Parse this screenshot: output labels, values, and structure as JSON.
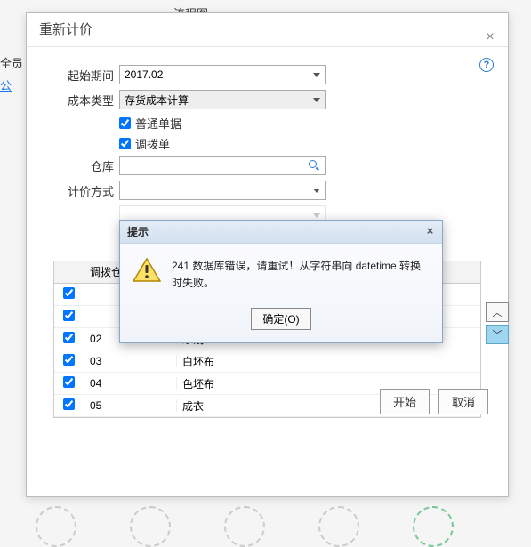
{
  "background": {
    "flowchart_label": "流程图",
    "members_label": "全员",
    "public_label": "公"
  },
  "dialog": {
    "title": "重新计价",
    "close": "×",
    "help": "?",
    "fields": {
      "start_period_label": "起始期间",
      "start_period_value": "2017.02",
      "cost_type_label": "成本类型",
      "cost_type_value": "存货成本计算",
      "normal_receipt_label": "普通单据",
      "transfer_receipt_label": "调拨单",
      "warehouse_label": "仓库",
      "warehouse_value": "",
      "pricing_method_label": "计价方式",
      "pricing_method_value": ""
    },
    "table": {
      "header_code": "调拨仓",
      "header_name": "",
      "rows": [
        {
          "checked": true,
          "code": "",
          "name": ""
        },
        {
          "checked": true,
          "code": "",
          "name": ""
        },
        {
          "checked": true,
          "code": "02",
          "name": "纱线"
        },
        {
          "checked": true,
          "code": "03",
          "name": "白坯布"
        },
        {
          "checked": true,
          "code": "04",
          "name": "色坯布"
        },
        {
          "checked": true,
          "code": "05",
          "name": "成衣"
        }
      ]
    },
    "side_buttons": {
      "up": "︿",
      "down": "﹀"
    },
    "buttons": {
      "start": "开始",
      "cancel": "取消"
    }
  },
  "alert": {
    "title": "提示",
    "close": "×",
    "message": "241 数据库错误，请重试！从字符串向 datetime 转换时失败。",
    "ok_label": "确定(O)"
  }
}
